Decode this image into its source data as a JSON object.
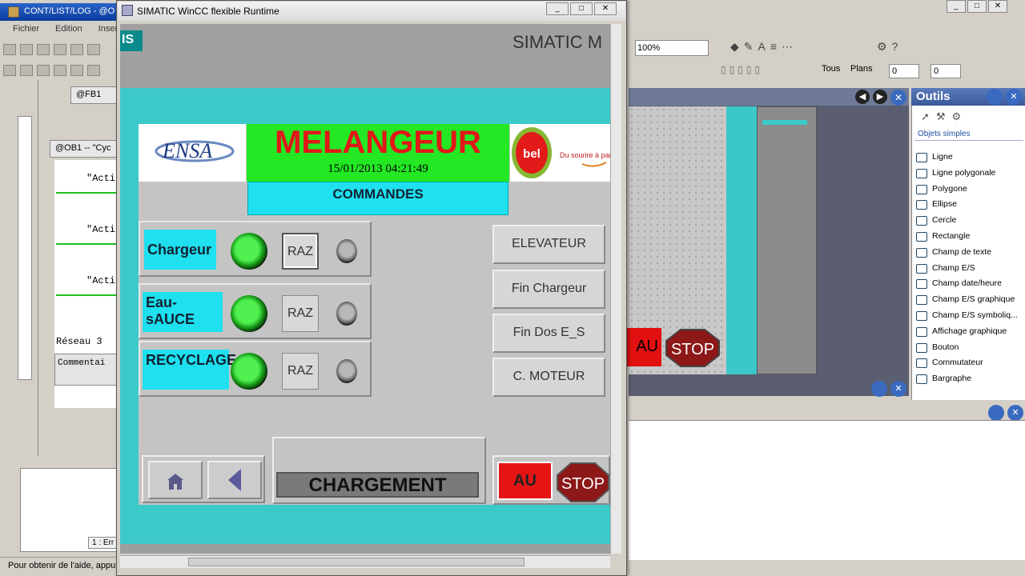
{
  "background_app": {
    "title": "CONT/LIST/LOG - @O",
    "menu": [
      "Fichier",
      "Edition",
      "Insertio"
    ],
    "tabs": [
      "@FB1",
      "@OB1 -- \"Cyc"
    ],
    "code_lines": [
      "\"Acti",
      "\"Acti",
      "\"Acti"
    ],
    "reseau": "Réseau  3",
    "commentaire": "Commentai",
    "bottom_tab": "1 : Err",
    "status": "Pour obtenir de l'aide, appu",
    "zoom": "100%",
    "tous": "Tous",
    "plans": "Plans",
    "spin1": "0",
    "spin2": "0",
    "preview_au": "AU"
  },
  "outils": {
    "title": "Outils",
    "section": "Objets simples",
    "items": [
      "Ligne",
      "Ligne polygonale",
      "Polygone",
      "Ellipse",
      "Cercle",
      "Rectangle",
      "Champ de texte",
      "Champ E/S",
      "Champ date/heure",
      "Champ E/S graphique",
      "Champ E/S symboliq...",
      "Affichage graphique",
      "Bouton",
      "Commutateur",
      "Bargraphe"
    ]
  },
  "runtime": {
    "title": "SIMATIC WinCC flexible Runtime",
    "brand": "SIMATIC M",
    "logo_text": "IS",
    "header_title": "MELANGEUR",
    "datetime": "15/01/2013 04:21:49",
    "commandes": "COMMANDES",
    "ensa_logo": "ENSA",
    "bel_logo": "bel",
    "bel_slogan": "Du sourire à parta",
    "groups": [
      {
        "label": "Chargeur",
        "raz": "RAZ"
      },
      {
        "label": "Eau-sAUCE",
        "raz": "RAZ"
      },
      {
        "label": "RECYCLAGE",
        "raz": "RAZ"
      }
    ],
    "commands": [
      "ELEVATEUR",
      "Fin Chargeur",
      "Fin Dos E_S",
      "C. MOTEUR"
    ],
    "state": "CHARGEMENT",
    "au": "AU",
    "stop": "STOP"
  },
  "colors": {
    "teal": "#3ec9c9",
    "cyan_label": "#1fe0ee",
    "green_header": "#23e823",
    "title_red": "#e01818",
    "au_red": "#e51515",
    "stop_red": "#8c1818"
  }
}
